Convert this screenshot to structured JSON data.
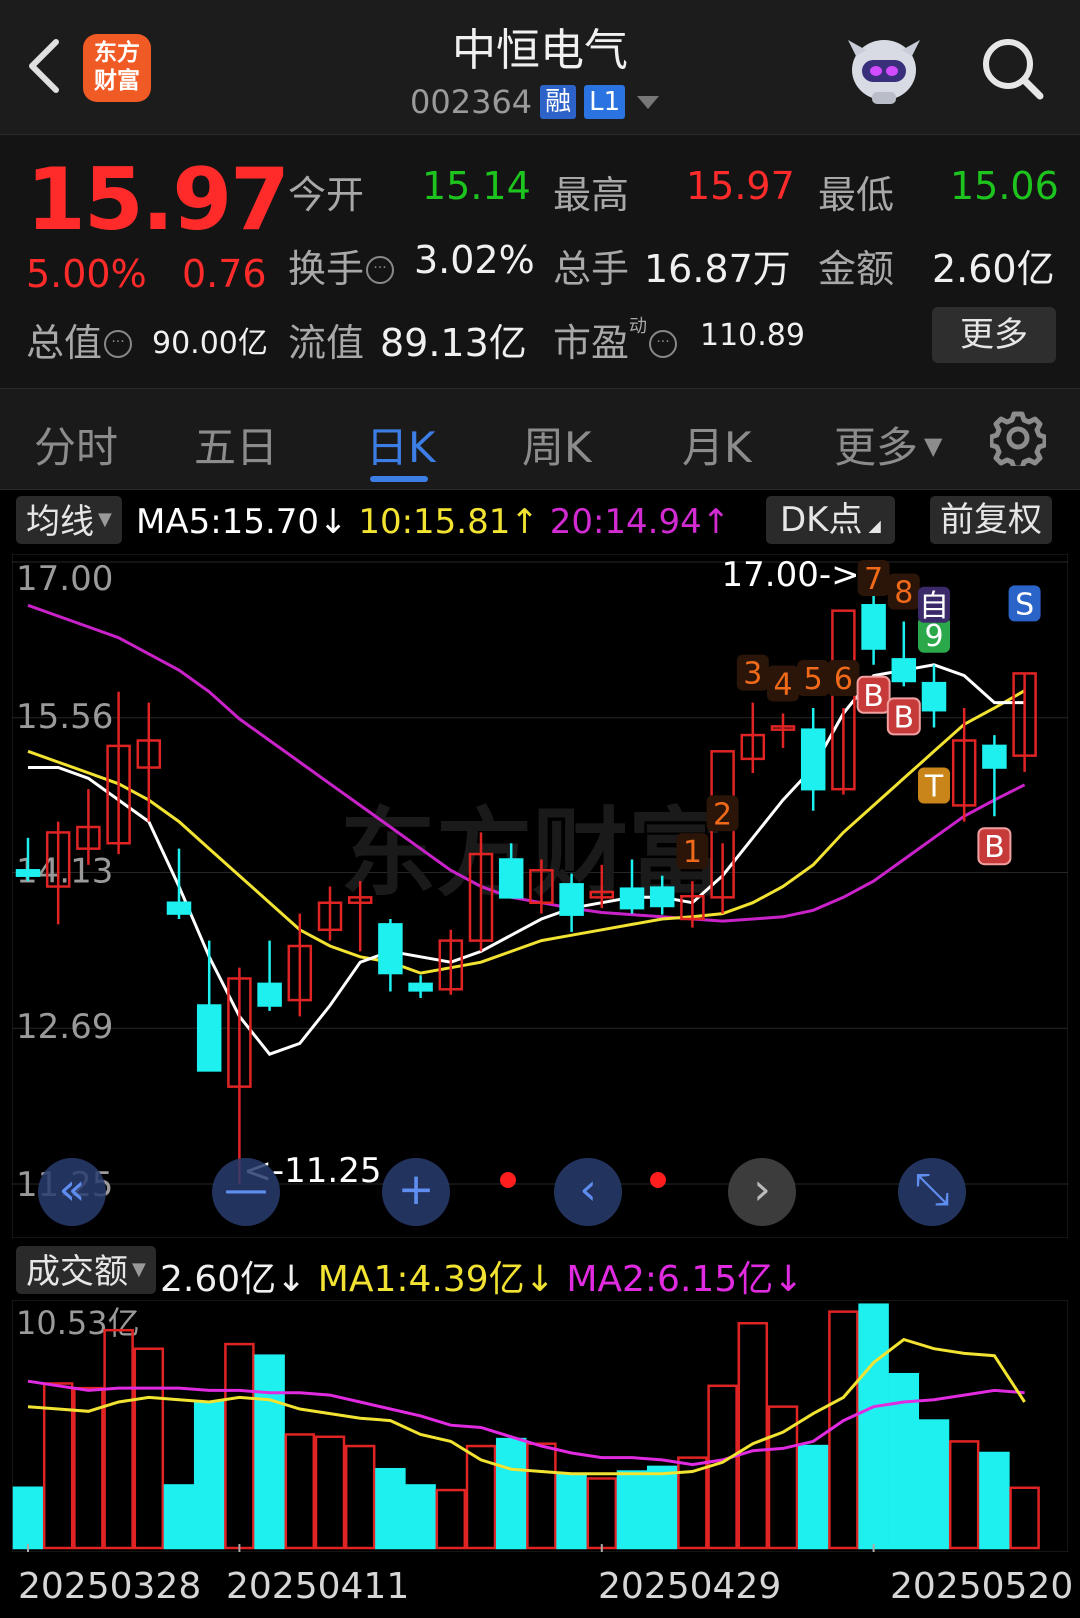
{
  "header": {
    "back_icon": "chevron-left-icon",
    "logo_line1": "东方",
    "logo_line2": "财富",
    "title": "中恒电气",
    "code": "002364",
    "tag_margin": "融",
    "tag_level": "L1",
    "search_icon": "search-icon"
  },
  "quote": {
    "price": "15.97",
    "change_pct": "5.00%",
    "change_amt": "0.76",
    "open_label": "今开",
    "open_value": "15.14",
    "high_label": "最高",
    "high_value": "15.97",
    "low_label": "最低",
    "low_value": "15.06",
    "turnover_label": "换手",
    "turnover_value": "3.02%",
    "volume_label": "总手",
    "volume_value": "16.87万",
    "amount_label": "金额",
    "amount_value": "2.60亿",
    "mktcap_label": "总值",
    "mktcap_value": "90.00亿",
    "float_label": "流值",
    "float_value": "89.13亿",
    "pe_label": "市盈",
    "pe_sup": "动",
    "pe_value": "110.89",
    "more_label": "更多",
    "colors": {
      "up": "#ff2b2b",
      "down": "#1ec41e"
    }
  },
  "tabs": [
    {
      "label": "分时"
    },
    {
      "label": "五日"
    },
    {
      "label": "日K",
      "active": true
    },
    {
      "label": "周K"
    },
    {
      "label": "月K"
    },
    {
      "label": "更多"
    }
  ],
  "legend": {
    "ma_select": "均线",
    "ma5": "MA5:15.70",
    "ma10": "10:15.81",
    "ma20": "20:14.94",
    "dk_select": "DK点",
    "adjust_select": "前复权",
    "vol_select": "成交额",
    "vol_value": "2.60亿",
    "vol_ma1": "MA1:4.39亿",
    "vol_ma2": "MA2:6.15亿"
  },
  "chart_data": {
    "type": "candlestick",
    "ylim": [
      11.25,
      17.0
    ],
    "ytick_labels": [
      "17.00",
      "15.56",
      "14.13",
      "12.69",
      "11.25"
    ],
    "high_label": "17.00->",
    "low_label": "<-11.25",
    "watermark": "东方财富",
    "ohlc": [
      [
        14.15,
        14.45,
        14.05,
        14.1
      ],
      [
        14.0,
        14.6,
        13.65,
        14.5
      ],
      [
        14.35,
        14.9,
        14.2,
        14.55
      ],
      [
        14.4,
        15.8,
        14.3,
        15.3
      ],
      [
        15.1,
        15.7,
        14.6,
        15.35
      ],
      [
        13.85,
        14.35,
        13.7,
        13.75
      ],
      [
        12.9,
        13.5,
        12.35,
        12.3
      ],
      [
        12.15,
        13.25,
        11.25,
        13.15
      ],
      [
        13.1,
        13.5,
        12.85,
        12.9
      ],
      [
        12.95,
        13.75,
        12.8,
        13.45
      ],
      [
        13.6,
        14.0,
        13.5,
        13.85
      ],
      [
        13.85,
        14.05,
        13.4,
        13.9
      ],
      [
        13.65,
        13.7,
        13.03,
        13.2
      ],
      [
        13.1,
        13.18,
        12.97,
        13.04
      ],
      [
        13.05,
        13.6,
        13.0,
        13.5
      ],
      [
        13.5,
        14.5,
        13.4,
        14.3
      ],
      [
        14.25,
        14.4,
        13.9,
        13.9
      ],
      [
        13.85,
        14.25,
        13.75,
        14.15
      ],
      [
        14.02,
        14.12,
        13.58,
        13.74
      ],
      [
        13.9,
        14.2,
        13.8,
        13.95
      ],
      [
        13.98,
        14.25,
        13.75,
        13.8
      ],
      [
        13.99,
        14.1,
        13.74,
        13.82
      ],
      [
        13.7,
        14.05,
        13.62,
        13.91
      ],
      [
        13.9,
        14.4,
        13.75,
        15.25
      ],
      [
        15.18,
        15.7,
        15.05,
        15.4
      ],
      [
        15.45,
        15.6,
        15.28,
        15.48
      ],
      [
        15.45,
        15.65,
        14.7,
        14.9
      ],
      [
        14.9,
        15.65,
        14.85,
        16.55
      ],
      [
        16.6,
        17.0,
        16.05,
        16.2
      ],
      [
        16.1,
        16.45,
        15.85,
        15.9
      ],
      [
        15.88,
        16.05,
        15.47,
        15.63
      ],
      [
        14.75,
        15.65,
        14.6,
        15.35
      ],
      [
        15.3,
        15.4,
        14.65,
        15.1
      ],
      [
        15.21,
        15.97,
        15.06,
        15.97
      ]
    ],
    "ma5": [
      15.1,
      15.1,
      15.0,
      14.8,
      14.6,
      14.0,
      13.35,
      12.8,
      12.45,
      12.55,
      12.9,
      13.3,
      13.4,
      13.35,
      13.3,
      13.4,
      13.55,
      13.7,
      13.8,
      13.85,
      13.9,
      13.9,
      13.85,
      14.1,
      14.45,
      14.8,
      15.1,
      15.6,
      15.95,
      16.0,
      16.05,
      15.95,
      15.7,
      15.7
    ],
    "ma10": [
      15.25,
      15.15,
      15.05,
      14.95,
      14.8,
      14.6,
      14.35,
      14.1,
      13.85,
      13.6,
      13.45,
      13.35,
      13.3,
      13.2,
      13.25,
      13.3,
      13.4,
      13.5,
      13.55,
      13.6,
      13.65,
      13.7,
      13.72,
      13.75,
      13.85,
      14.0,
      14.2,
      14.5,
      14.75,
      15.0,
      15.25,
      15.5,
      15.65,
      15.81
    ],
    "ma20": [
      16.6,
      16.5,
      16.4,
      16.3,
      16.15,
      16.0,
      15.8,
      15.55,
      15.35,
      15.15,
      14.95,
      14.75,
      14.55,
      14.35,
      14.15,
      14.0,
      13.9,
      13.85,
      13.8,
      13.76,
      13.74,
      13.72,
      13.7,
      13.68,
      13.7,
      13.72,
      13.78,
      13.9,
      14.05,
      14.25,
      14.45,
      14.65,
      14.8,
      14.94
    ],
    "signals": [
      {
        "i": 22,
        "text": "1",
        "kind": "num"
      },
      {
        "i": 23,
        "text": "2",
        "kind": "num"
      },
      {
        "i": 24,
        "text": "3",
        "kind": "num"
      },
      {
        "i": 25,
        "text": "4",
        "kind": "num"
      },
      {
        "i": 26,
        "text": "5",
        "kind": "num"
      },
      {
        "i": 27,
        "text": "6",
        "kind": "num"
      },
      {
        "i": 28,
        "text": "7",
        "kind": "num"
      },
      {
        "i": 29,
        "text": "8",
        "kind": "num"
      },
      {
        "i": 30,
        "text": "9",
        "kind": "num9"
      },
      {
        "i": 28,
        "text": "B",
        "kind": "buy"
      },
      {
        "i": 29,
        "text": "B",
        "kind": "buy"
      },
      {
        "i": 32,
        "text": "B",
        "kind": "buy"
      },
      {
        "i": 30,
        "text": "T",
        "kind": "t"
      },
      {
        "i": 30,
        "text": "自",
        "kind": "self"
      },
      {
        "i": 33,
        "text": "S",
        "kind": "sell"
      }
    ],
    "volume_label_top": "10.53亿",
    "volume": [
      2.6,
      7.1,
      6.9,
      9.4,
      8.6,
      2.7,
      6.3,
      8.8,
      8.3,
      4.9,
      4.8,
      4.4,
      3.4,
      2.7,
      2.5,
      4.4,
      4.7,
      4.5,
      3.2,
      3.0,
      3.3,
      3.5,
      3.9,
      7.0,
      9.7,
      6.1,
      4.4,
      10.2,
      10.5,
      7.5,
      5.5,
      4.6,
      4.1,
      2.6
    ],
    "vol_ma1": [
      6.1,
      6.0,
      5.9,
      6.3,
      6.5,
      6.4,
      6.3,
      6.5,
      6.4,
      6.0,
      5.8,
      5.6,
      5.5,
      4.9,
      4.6,
      3.8,
      3.4,
      3.3,
      3.2,
      3.2,
      3.2,
      3.2,
      3.3,
      3.7,
      4.5,
      5.0,
      5.8,
      6.5,
      8.0,
      9.0,
      8.6,
      8.4,
      8.3,
      6.3
    ],
    "vol_ma2": [
      7.2,
      7.0,
      6.8,
      6.9,
      6.9,
      6.9,
      6.8,
      6.8,
      6.7,
      6.7,
      6.6,
      6.3,
      6.0,
      5.7,
      5.3,
      5.2,
      4.8,
      4.4,
      4.1,
      3.9,
      3.9,
      3.8,
      3.6,
      3.8,
      4.2,
      4.3,
      4.6,
      5.5,
      6.1,
      6.3,
      6.4,
      6.6,
      6.8,
      6.7
    ],
    "dates": [
      "20250328",
      "20250411",
      "20250429",
      "20250520"
    ]
  },
  "chart_controls": [
    {
      "name": "fast-backward-button",
      "icon": "double-chevron-left-icon"
    },
    {
      "name": "zoom-out-button",
      "icon": "minus-icon"
    },
    {
      "name": "zoom-in-button",
      "icon": "plus-icon"
    },
    {
      "name": "step-back-button",
      "icon": "chevron-left-icon"
    },
    {
      "name": "step-forward-button",
      "icon": "chevron-right-icon"
    },
    {
      "name": "fullscreen-button",
      "icon": "expand-icon"
    }
  ]
}
